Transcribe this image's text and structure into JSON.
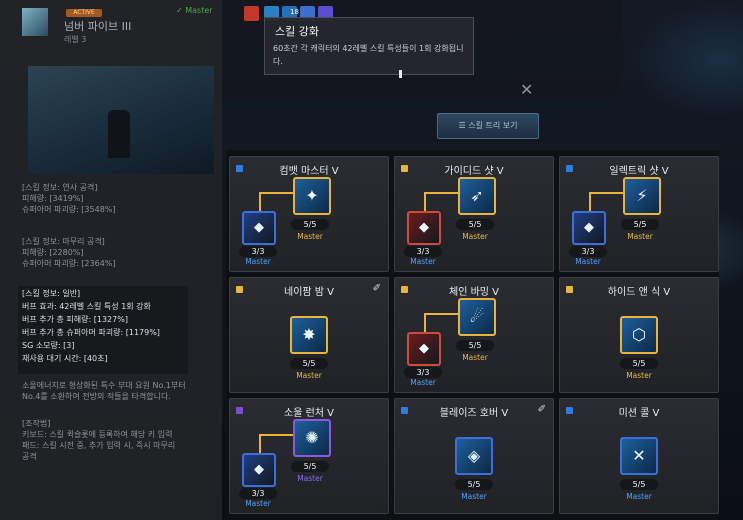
{
  "left_panel": {
    "status_badge": "ACTIVE",
    "master_check": "✓ Master",
    "skill_title": "넘버 파이브 III",
    "skill_level": "레벨 3",
    "info_blocks": [
      [
        "[스킬 정보: 연사 공격]",
        "피해량: [3419%]",
        "슈퍼아머 파괴량: [3548%]"
      ],
      [
        "[스킬 정보: 마무리 공격]",
        "피해량: [2280%]",
        "슈퍼아머 파괴량: [2364%]"
      ]
    ],
    "general_info": [
      "[스킬 정보: 일반]",
      "버프 효과: 42레벨 스킬 특성 1회 강화",
      "버프 추가 총 피해량: [1327%]",
      "버프 추가 총 슈퍼아머 파괴량: [1179%]",
      "SG 소모량: [3]",
      "재사용 대기 시간: [40초]"
    ],
    "description": [
      "소울에너지로 형상화된 특수 부대 요원 No.1부터",
      "No.4를 소환하여 전방의 적들을 타격합니다."
    ],
    "controls": [
      "[조작법]",
      "키보드: 스킬 퀵슬롯에 등록하여 해당 키 입력",
      "패드: 스킬 시전 중, 추가 입력 시, 즉시 마무리",
      "공격"
    ]
  },
  "tooltip": {
    "title": "스킬 강화",
    "description": "60초간 각 캐릭터의 42레벨 스킬 특성들이 1회 강화됩니다."
  },
  "buff_bar": {
    "count_label": "18"
  },
  "tree_button": "스킬 트리 보기",
  "colors": {
    "gold": "#e4ba52",
    "blue": "#4fa0ff",
    "purple": "#8e6cf0",
    "red": "#cf4a3c"
  },
  "cards": [
    {
      "name": "컴뱃 마스터 V",
      "dot": "blue",
      "pinned": false,
      "main": {
        "level": "5/5",
        "mastery": "Master",
        "icon": "combat-master-icon"
      },
      "sub": {
        "level": "3/3",
        "mastery": "Master",
        "icon": "combat-sub-icon"
      }
    },
    {
      "name": "가이디드 샷 V",
      "dot": "gold",
      "pinned": false,
      "main": {
        "level": "5/5",
        "mastery": "Master",
        "icon": "guided-shot-icon"
      },
      "sub": {
        "level": "3/3",
        "mastery": "Master",
        "icon": "guided-sub-icon"
      }
    },
    {
      "name": "일렉트릭 샷 V",
      "dot": "blue",
      "pinned": false,
      "main": {
        "level": "5/5",
        "mastery": "Master",
        "icon": "electric-shot-icon"
      },
      "sub": {
        "level": "3/3",
        "mastery": "Master",
        "icon": "electric-sub-icon"
      }
    },
    {
      "name": "네이팜 밤 V",
      "dot": "gold",
      "pinned": true,
      "main": {
        "level": "5/5",
        "mastery": "Master",
        "icon": "napalm-bomb-icon"
      }
    },
    {
      "name": "체인 바밍 V",
      "dot": "gold",
      "pinned": false,
      "main": {
        "level": "5/5",
        "mastery": "Master",
        "icon": "chain-bombing-icon"
      },
      "sub": {
        "level": "3/3",
        "mastery": "Master",
        "icon": "chain-sub-icon"
      }
    },
    {
      "name": "하이드 앤 식 V",
      "dot": "gold",
      "pinned": false,
      "main": {
        "level": "5/5",
        "mastery": "Master",
        "icon": "hide-and-seek-icon"
      }
    },
    {
      "name": "소울 런처 V",
      "dot": "purple",
      "pinned": false,
      "main": {
        "level": "5/5",
        "mastery": "Master",
        "icon": "soul-launcher-icon"
      },
      "sub": {
        "level": "3/3",
        "mastery": "Master",
        "icon": "soul-sub-icon"
      }
    },
    {
      "name": "블레이즈 호버 V",
      "dot": "blue",
      "pinned": true,
      "main": {
        "level": "5/5",
        "mastery": "Master",
        "icon": "blaze-hover-icon"
      }
    },
    {
      "name": "미션 콜 V",
      "dot": "blue",
      "pinned": false,
      "main": {
        "level": "5/5",
        "mastery": "Master",
        "icon": "mission-call-icon"
      }
    }
  ]
}
